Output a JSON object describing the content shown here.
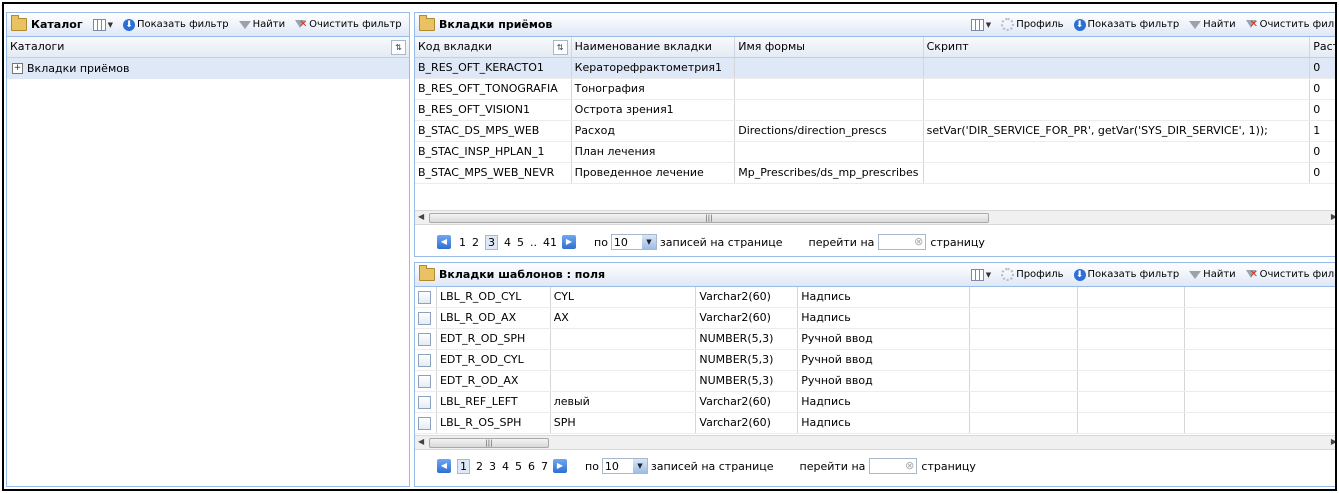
{
  "left_panel": {
    "title": "Каталог",
    "toolbar": {
      "show_filter": "Показать фильтр",
      "find": "Найти",
      "clear_filter": "Очистить фильтр"
    },
    "column_header": "Каталоги",
    "tree_items": [
      {
        "label": "Вкладки приёмов",
        "expanded": false,
        "selected": true
      }
    ]
  },
  "top_panel": {
    "title": "Вкладки приёмов",
    "toolbar": {
      "profile": "Профиль",
      "show_filter": "Показать фильтр",
      "find": "Найти",
      "clear_filter": "Очистить филь"
    },
    "columns": [
      "Код вкладки",
      "Наименование вкладки",
      "Имя формы",
      "Скрипт",
      "Растя"
    ],
    "rows": [
      [
        "B_RES_OFT_KERACTO1",
        "Кераторефрактометрия1",
        "",
        "",
        "0"
      ],
      [
        "B_RES_OFT_TONOGRAFIA",
        "Тонография",
        "",
        "",
        "0"
      ],
      [
        "B_RES_OFT_VISION1",
        "Острота зрения1",
        "",
        "",
        "0"
      ],
      [
        "B_STAC_DS_MPS_WEB",
        "Расход",
        "Directions/direction_prescs",
        "setVar('DIR_SERVICE_FOR_PR', getVar('SYS_DIR_SERVICE', 1));",
        "1"
      ],
      [
        "B_STAC_INSP_HPLAN_1",
        "План лечения",
        "",
        "",
        "0"
      ],
      [
        "B_STAC_MPS_WEB_NEVR",
        "Проведенное лечение",
        "Mp_Prescribes/ds_mp_prescribes",
        "",
        "0"
      ]
    ],
    "pager": {
      "pages": [
        "1",
        "2",
        "3",
        "4",
        "5",
        "..",
        "41"
      ],
      "current": "3",
      "per_page_prefix": "по",
      "per_page_value": "10",
      "per_page_suffix": "записей на странице",
      "goto_prefix": "перейти на",
      "goto_suffix": "страницу"
    }
  },
  "bottom_panel": {
    "title": "Вкладки шаблонов : поля",
    "toolbar": {
      "profile": "Профиль",
      "show_filter": "Показать фильтр",
      "find": "Найти",
      "clear_filter": "Очистить филь"
    },
    "rows": [
      [
        "LBL_R_OD_CYL",
        "CYL",
        "Varchar2(60)",
        "Надпись"
      ],
      [
        "LBL_R_OD_AX",
        "AX",
        "Varchar2(60)",
        "Надпись"
      ],
      [
        "EDT_R_OD_SPH",
        "",
        "NUMBER(5,3)",
        "Ручной ввод"
      ],
      [
        "EDT_R_OD_CYL",
        "",
        "NUMBER(5,3)",
        "Ручной ввод"
      ],
      [
        "EDT_R_OD_AX",
        "",
        "NUMBER(5,3)",
        "Ручной ввод"
      ],
      [
        "LBL_REF_LEFT",
        "левый",
        "Varchar2(60)",
        "Надпись"
      ],
      [
        "LBL_R_OS_SPH",
        "SPH",
        "Varchar2(60)",
        "Надпись"
      ]
    ],
    "pager": {
      "pages": [
        "1",
        "2",
        "3",
        "4",
        "5",
        "6",
        "7"
      ],
      "current": "1",
      "per_page_prefix": "по",
      "per_page_value": "10",
      "per_page_suffix": "записей на странице",
      "goto_prefix": "перейти на",
      "goto_suffix": "страницу"
    }
  },
  "colors": {
    "header_border": "#99bbe8",
    "selection": "#dfe8f6",
    "accent": "#2b6fd6"
  }
}
